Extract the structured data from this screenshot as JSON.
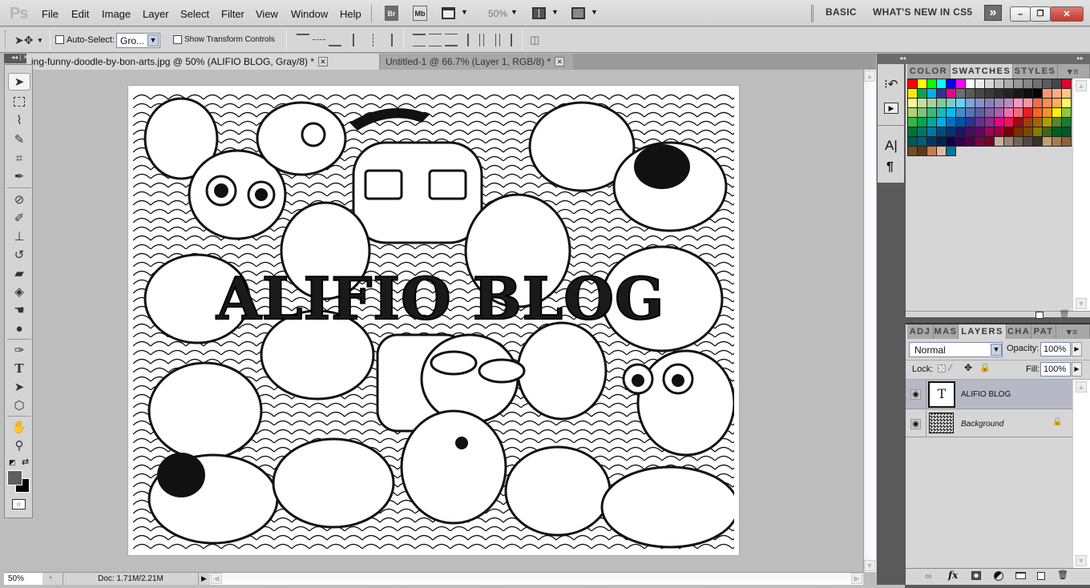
{
  "app": {
    "logo": "Ps"
  },
  "menu": [
    "File",
    "Edit",
    "Image",
    "Layer",
    "Select",
    "Filter",
    "View",
    "Window",
    "Help"
  ],
  "appbar": {
    "bridge": "Br",
    "minibridge": "Mb",
    "zoom": "50%"
  },
  "workspace": {
    "basic": "BASIC",
    "whats_new": "WHAT'S NEW IN CS5",
    "more": "»"
  },
  "window_controls": {
    "minimize": "–",
    "restore": "❐",
    "close": "✕"
  },
  "options": {
    "auto_select_label": "Auto-Select:",
    "auto_select_checked": false,
    "auto_select_value": "Gro...",
    "show_transform_label": "Show Transform Controls",
    "show_transform_checked": false
  },
  "tabs": [
    {
      "label": "ing-funny-doodle-by-bon-arts.jpg @ 50% (ALIFIO BLOG, Gray/8) *",
      "active": true
    },
    {
      "label": "Untitled-1 @ 66.7% (Layer 1, RGB/8) *",
      "active": false
    }
  ],
  "canvas": {
    "overlay_text": "ALIFIO BLOG"
  },
  "status": {
    "zoom": "50%",
    "doc": "Doc: 1.71M/2.21M"
  },
  "swatch_panel": {
    "tabs": [
      "COLOR",
      "SWATCHES",
      "STYLES"
    ],
    "active_tab": "SWATCHES",
    "swatches": [
      "#ff0000",
      "#ffff00",
      "#00ff00",
      "#00ffff",
      "#0000ff",
      "#ff00ff",
      "#ffffff",
      "#ebebeb",
      "#d6d6d6",
      "#c2c2c2",
      "#adadad",
      "#999999",
      "#858585",
      "#707070",
      "#5c5c5c",
      "#474747",
      "#e4002b",
      "#f6ec00",
      "#00a650",
      "#00aeef",
      "#2e3192",
      "#ec008c",
      "#6d6d6d",
      "#5a5a5a",
      "#474747",
      "#3a3a3a",
      "#2d2d2d",
      "#232323",
      "#181818",
      "#0e0e0e",
      "#050505",
      "#f7977a",
      "#f9ad81",
      "#fdc68a",
      "#fff79a",
      "#c4df9b",
      "#a3d39c",
      "#82ca9d",
      "#7bcdc8",
      "#6ecff6",
      "#7ea7d8",
      "#8493ca",
      "#8882be",
      "#a187be",
      "#bc8dbf",
      "#f49ac2",
      "#f6989d",
      "#f26c4f",
      "#f68e56",
      "#fbaf5d",
      "#fff568",
      "#acd372",
      "#7cc576",
      "#3bb878",
      "#1abbb4",
      "#00bff3",
      "#438ccb",
      "#5574b9",
      "#605ca8",
      "#855fa8",
      "#a763a9",
      "#f06eaa",
      "#f26d7d",
      "#ed1c24",
      "#f26522",
      "#f7941d",
      "#fff200",
      "#8dc73f",
      "#39b54a",
      "#00a651",
      "#00a99d",
      "#00aeef",
      "#0072bc",
      "#0054a5",
      "#2e3192",
      "#662d91",
      "#92278f",
      "#ec008c",
      "#ed145b",
      "#9e0b0f",
      "#a0410d",
      "#a36209",
      "#aba000",
      "#598527",
      "#197b30",
      "#007236",
      "#00746b",
      "#0076a3",
      "#004a80",
      "#003471",
      "#1b1464",
      "#440e62",
      "#630460",
      "#9e005d",
      "#9e0039",
      "#790000",
      "#7b2e00",
      "#7d4900",
      "#827b00",
      "#406618",
      "#005e20",
      "#005826",
      "#005952",
      "#005b7f",
      "#003663",
      "#002157",
      "#0d004c",
      "#32004b",
      "#4b0049",
      "#7b0046",
      "#7a0026",
      "#c7b299",
      "#998675",
      "#736357",
      "#534741",
      "#37302d",
      "#c69c6d",
      "#a67c52",
      "#8c6239",
      "#754c24",
      "#603913",
      "#c47d53",
      "#e5b9a0",
      "#0076a3"
    ]
  },
  "layers_panel": {
    "tabs": [
      "ADJ",
      "MAS",
      "LAYERS",
      "CHA",
      "PAT"
    ],
    "active_tab": "LAYERS",
    "blend_mode": "Normal",
    "opacity_label": "Opacity:",
    "opacity": "100%",
    "lock_label": "Lock:",
    "fill_label": "Fill:",
    "fill": "100%",
    "layers": [
      {
        "name": "ALIFIO BLOG",
        "type": "text",
        "visible": true,
        "selected": true,
        "thumb": "T"
      },
      {
        "name": "Background",
        "type": "image",
        "visible": true,
        "selected": false,
        "locked": true
      }
    ]
  },
  "colors": {
    "foreground": "#5e5e5e",
    "background": "#000000",
    "close_red": "#c8463a",
    "selected_layer": "#b6b9c5"
  }
}
